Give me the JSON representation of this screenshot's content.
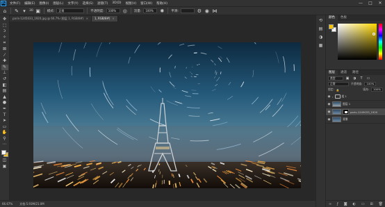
{
  "menu": {
    "logo": "Ps",
    "items": [
      "文件(F)",
      "编辑(E)",
      "图像(I)",
      "图层(L)",
      "文字(Y)",
      "选择(S)",
      "滤镜(T)",
      "3D(D)",
      "视图(V)",
      "窗口(W)",
      "帮助(H)"
    ],
    "window_controls": [
      "—",
      "□",
      "✕"
    ]
  },
  "options": {
    "brush_size": "30",
    "mode_label": "模式:",
    "mode_value": "正常",
    "opacity_label": "不透明度:",
    "opacity_value": "100%",
    "flow_label": "流量:",
    "flow_value": "100%",
    "smooth_label": "平滑:"
  },
  "tabs": [
    {
      "label": "paris-1245033_1920.jpg @ 66.7% (图层 1, RGB/8#)",
      "close": "×"
    },
    {
      "label": "1, RGB/8#)",
      "close": "×"
    }
  ],
  "status": {
    "zoom": "66.67%",
    "doc": "文档:5.93M/21.0M"
  },
  "panels": {
    "color_tab": "颜色",
    "swatches_tab": "色板",
    "layers_tab": "图层",
    "channels_tab": "通道",
    "paths_tab": "路径",
    "filter_kind": "类型",
    "blend_mode": "正常",
    "opacity_label": "不透明度:",
    "opacity_value": "100%",
    "lock_label": "锁定:",
    "fill_label": "填充:",
    "fill_value": "100%",
    "layers": [
      {
        "name": "组 1",
        "type": "group",
        "selected": false
      },
      {
        "name": "图层 1",
        "type": "layer",
        "selected": false
      },
      {
        "name": "paris-1245033_1920",
        "type": "masked",
        "selected": true
      },
      {
        "name": "背景",
        "type": "layer",
        "selected": false
      }
    ]
  },
  "colors": {
    "foreground": "#f5f5f5",
    "background": "#f0c020",
    "picker_foreground": "#f5c400"
  }
}
